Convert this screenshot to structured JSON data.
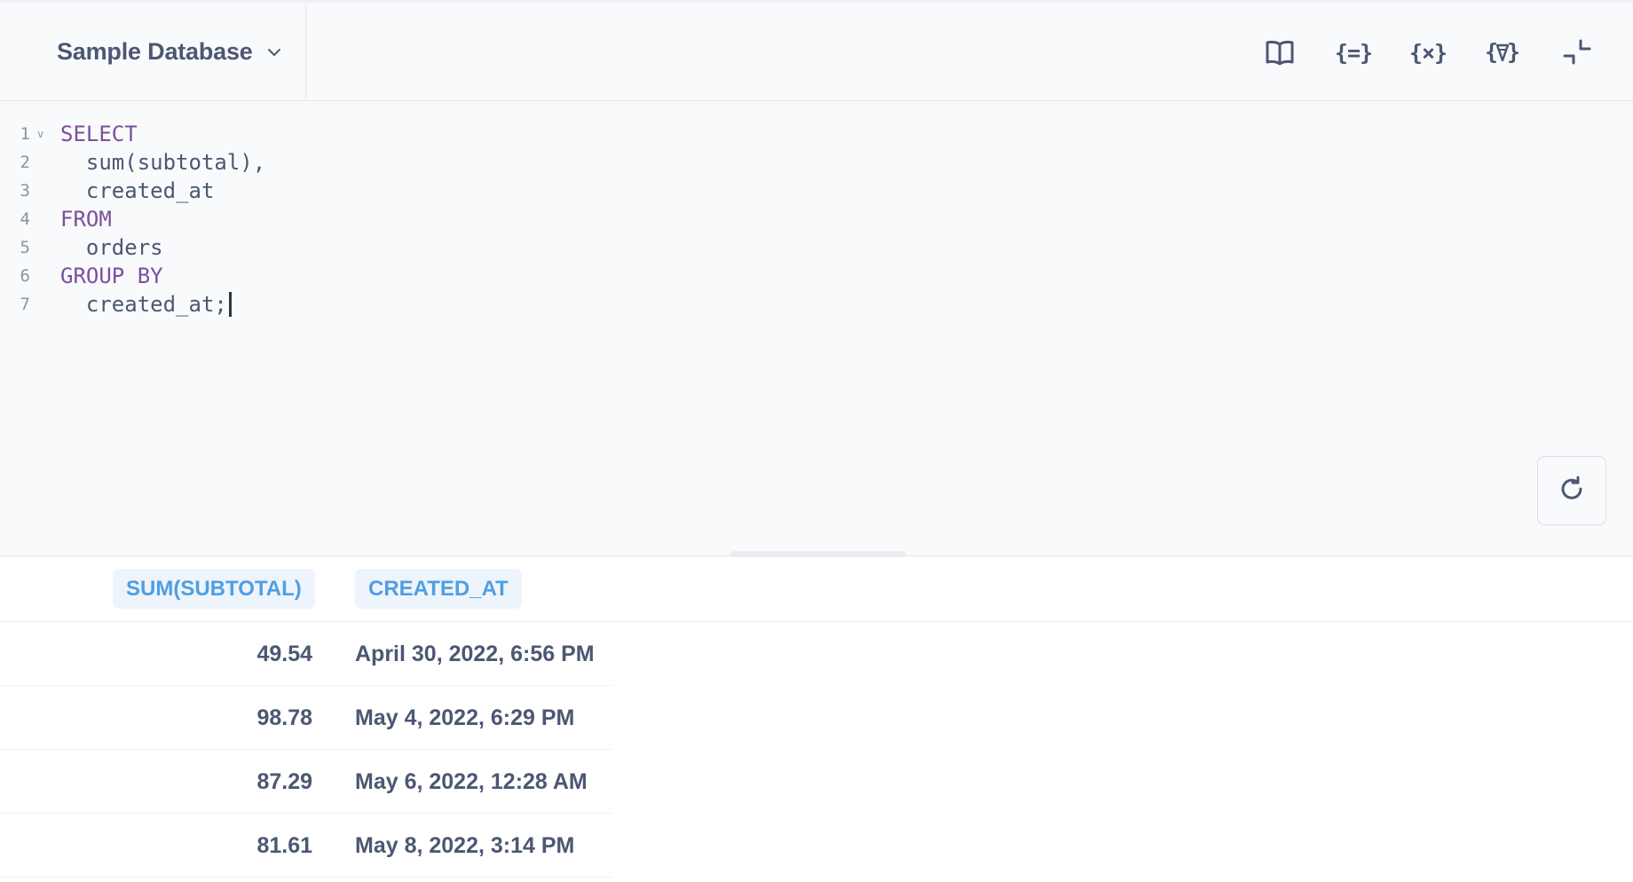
{
  "toolbar": {
    "database_name": "Sample Database",
    "icons": [
      "book-icon",
      "snippet-icon",
      "variables-icon",
      "snippets-library-icon",
      "collapse-icon"
    ],
    "snippet_label": "{=}",
    "variables_label": "{×}"
  },
  "editor": {
    "lines": [
      {
        "num": "1",
        "text": "SELECT",
        "keyword": true,
        "fold": "v"
      },
      {
        "num": "2",
        "text": "  sum(subtotal),",
        "keyword": false
      },
      {
        "num": "3",
        "text": "  created_at",
        "keyword": false
      },
      {
        "num": "4",
        "text": "FROM",
        "keyword": true
      },
      {
        "num": "5",
        "text": "  orders",
        "keyword": false
      },
      {
        "num": "6",
        "text": "GROUP BY",
        "keyword": true
      },
      {
        "num": "7",
        "text": "  created_at;",
        "keyword": false
      }
    ],
    "refresh_icon": "refresh-icon"
  },
  "results": {
    "columns": [
      "SUM(SUBTOTAL)",
      "CREATED_AT"
    ],
    "rows": [
      [
        "49.54",
        "April 30, 2022, 6:56 PM"
      ],
      [
        "98.78",
        "May 4, 2022, 6:29 PM"
      ],
      [
        "87.29",
        "May 6, 2022, 12:28 AM"
      ],
      [
        "81.61",
        "May 8, 2022, 3:14 PM"
      ]
    ]
  },
  "colors": {
    "keyword": "#7c4f9e",
    "column_header": "#509ee3",
    "text": "#4c5773"
  }
}
